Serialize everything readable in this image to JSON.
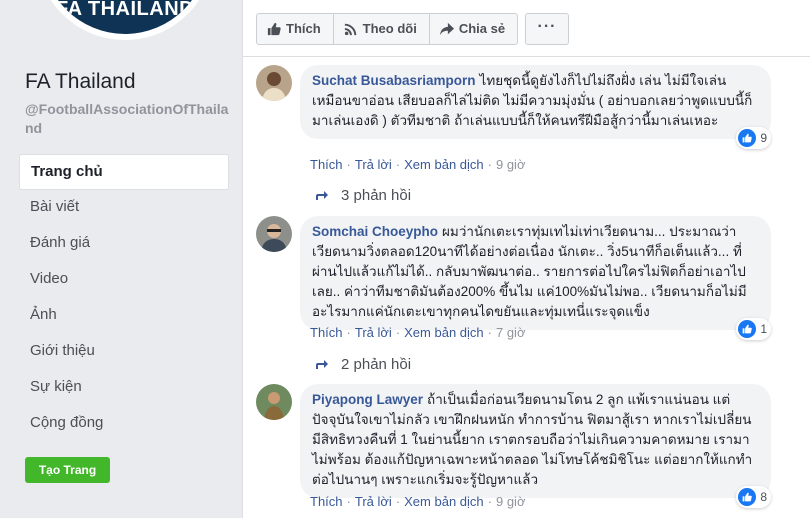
{
  "sidebar": {
    "logo_text": "FA THAILAND",
    "page_name": "FA Thailand",
    "page_handle": "@FootballAssociationOfThailand",
    "nav": [
      {
        "label": "Trang chủ",
        "active": true
      },
      {
        "label": "Bài viết"
      },
      {
        "label": "Đánh giá"
      },
      {
        "label": "Video"
      },
      {
        "label": "Ảnh"
      },
      {
        "label": "Giới thiệu"
      },
      {
        "label": "Sự kiện"
      },
      {
        "label": "Cộng đồng"
      }
    ],
    "create_page": "Tạo Trang"
  },
  "actions": {
    "like": "Thích",
    "follow": "Theo dõi",
    "share": "Chia sẻ",
    "more": "···"
  },
  "comment_actions": {
    "like": "Thích",
    "reply": "Trả lời",
    "translate": "Xem bản dịch"
  },
  "comments": [
    {
      "name": "Suchat Busabasriamporn",
      "text": "ไทยชุดนี้ดูยังไงก็ไปไม่ถึงฝั่ง เล่น ไม่มีใจเล่น เหมือนขาอ่อน เสียบอลก็ไล่ไม่ติด ไม่มีความมุ่งมั่น ( อย่าบอกเลยว่าพูดแบบนี้ก็มาเล่นเองดิ ) ตัวทีมชาติ ถ้าเล่นแบบนี้ก็ให้คนทรีฝีมือสู้กว่านี้มาเล่นเหอะ",
      "reactions": "9",
      "time": "9 giờ",
      "replies": "3 phản hồi"
    },
    {
      "name": "Somchai Choeypho",
      "text": "ผมว่านักเตะเราทุ่มเทไม่เท่าเวียดนาม... ประมาณว่าเวียดนามวิ่งตลอด120นาทีได้อย่างต่อเนื่อง นักเตะ.. วิ่ง5นาทีก็อเต็นแล้ว... ที่ผ่านไปแล้วแก้ไม่ได้.. กลับมาพัฒนาต่อ.. รายการต่อไปใครไม่ฟิตก็อย่าเอาไปเลย.. ค่าว่าทีมชาติมันต้อง200% ขึ้นไม แค่100%มันไม่พอ.. เวียดนามก็อไม่มีอะไรมากแค่นักเตะเขาทุกคนไดขยันและทุ่มเทนี่แระจุดแข็ง",
      "reactions": "1",
      "time": "7 giờ",
      "replies": "2 phản hồi"
    },
    {
      "name": "Piyapong Lawyer",
      "text": "ถ้าเป็นเมื่อก่อนเวียดนามโดน 2 ลูก แพ้เราแน่นอน แต่ปัจจุบันใจเขาไม่กลัว เขาฝึกฝนหนัก ทำการบ้าน ฟิตมาสู้เรา หากเราไม่เปลี่ยน มีสิทธิทวงคืนที่ 1 ในย่านนี้ยาก เราตกรอบถือว่าไม่เกินความคาดหมาย เรามาไม่พร้อม ต้องแก้ปัญหาเฉพาะหน้าตลอด ไม่โทษโค้ชมิชิโนะ แต่อยากให้แกทำต่อไปนานๆ เพราะแกเริ่มจะรู้ปัญหาแล้ว",
      "reactions": "8",
      "time": "9 giờ",
      "replies": ""
    }
  ],
  "colors": {
    "link": "#385898",
    "like_blue": "#1877f2",
    "create_green": "#42b72a",
    "logo_navy": "#0f3354"
  },
  "icons": [
    "thumb-up-icon",
    "rss-follow-icon",
    "share-arrow-icon",
    "reply-arrow-icon"
  ]
}
